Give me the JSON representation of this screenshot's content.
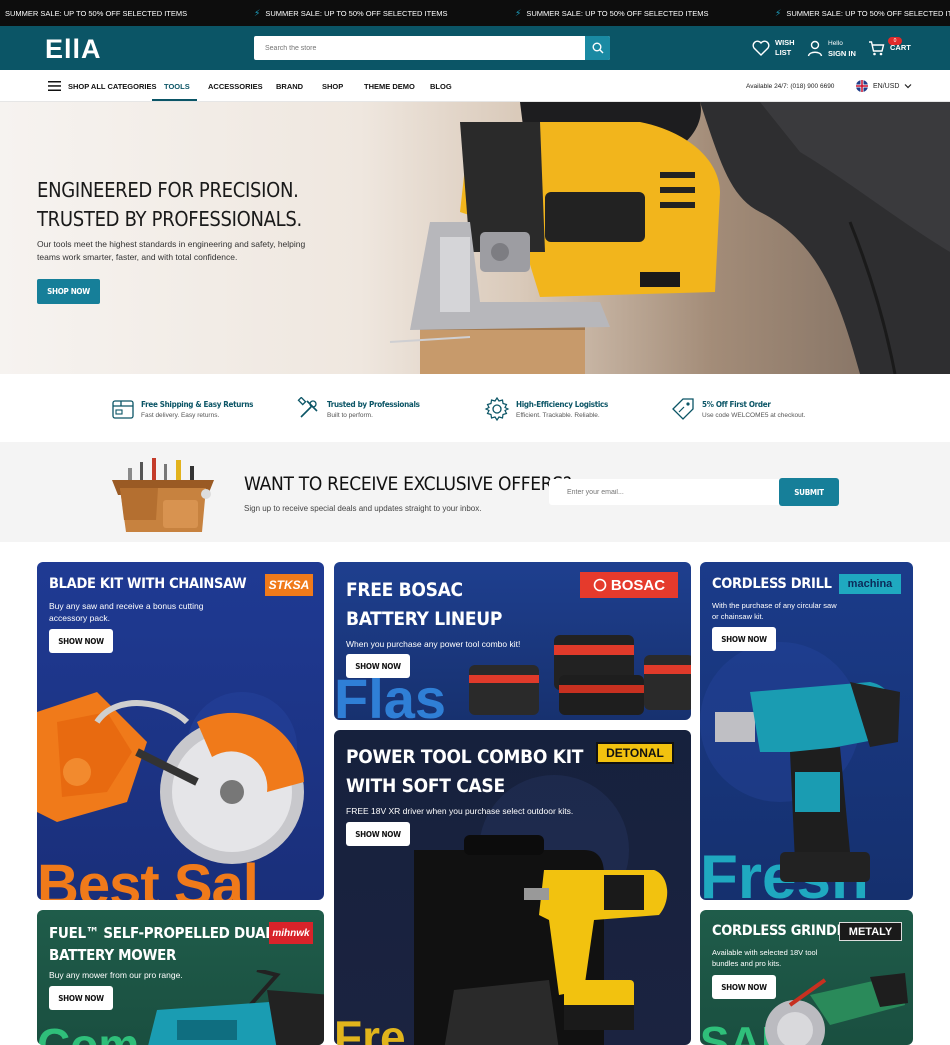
{
  "announcement": {
    "text": "SUMMER SALE: UP TO 50% OFF SELECTED ITEMS"
  },
  "header": {
    "logo": "EllA",
    "search_placeholder": "Search the store",
    "wishlist_line1": "WISH",
    "wishlist_line2": "LIST",
    "account_line1": "Hello",
    "account_line2": "SIGN IN",
    "cart_label": "CART",
    "cart_count": "0"
  },
  "nav": {
    "all_categories": "SHOP ALL CATEGORIES",
    "items": [
      "TOOLS",
      "ACCESSORIES",
      "BRAND",
      "SHOP",
      "THEME DEMO",
      "BLOG"
    ],
    "contact": "Available 24/7: (018) 900 6690",
    "language": "EN/USD"
  },
  "hero": {
    "title_line1": "ENGINEERED FOR PRECISION.",
    "title_line2": "TRUSTED BY PROFESSIONALS.",
    "subtitle": "Our tools meet the highest standards in engineering and safety, helping teams work smarter, faster, and with total confidence.",
    "button": "SHOP NOW"
  },
  "features": [
    {
      "title": "Free Shipping & Easy Returns",
      "sub": "Fast delivery. Easy returns."
    },
    {
      "title": "Trusted by Professionals",
      "sub": "Built to perform."
    },
    {
      "title": "High-Efficiency Logistics",
      "sub": "Efficient. Trackable. Reliable."
    },
    {
      "title": "5% Off First Order",
      "sub": "Use code WELCOME5 at checkout."
    }
  ],
  "newsletter": {
    "title": "WANT TO RECEIVE EXCLUSIVE OFFERS?",
    "sub": "Sign up to receive special deals and updates straight to your inbox.",
    "placeholder": "Enter your email...",
    "button": "SUBMIT"
  },
  "cards": {
    "blade": {
      "title": "BLADE KIT WITH CHAINSAW",
      "text": "Buy any saw and receive a bonus cutting accessory pack.",
      "button": "SHOW NOW",
      "brand": "STKSA",
      "bigword": "Best Sal"
    },
    "bosac": {
      "title_line1": "FREE BOSAC",
      "title_line2": "BATTERY LINEUP",
      "text": "When you purchase any power tool combo kit!",
      "button": "SHOW NOW",
      "brand": "BOSAC",
      "bigword": "Flas"
    },
    "drill": {
      "title": "CORDLESS DRILL",
      "text": "With the purchase of any circular saw or chainsaw kit.",
      "button": "SHOW NOW",
      "brand": "machina",
      "bigword": "Fresh"
    },
    "combo": {
      "title_line1": "POWER TOOL COMBO KIT",
      "title_line2": "WITH SOFT CASE",
      "text": "FREE 18V XR driver when you purchase select outdoor kits.",
      "button": "SHOW NOW",
      "brand": "DETONAL",
      "bigword": "Fre"
    },
    "mower": {
      "title_line1": "FUEL™ SELF-PROPELLED DUAL",
      "title_line2": "BATTERY MOWER",
      "text": "Buy any mower from our pro range.",
      "button": "SHOW NOW",
      "brand": "mihnwk",
      "bigword": "Com"
    },
    "grinder": {
      "title": "CORDLESS GRINDER",
      "text": "Available with selected 18V tool bundles and pro kits.",
      "button": "SHOW NOW",
      "brand": "METALY",
      "bigword": "SALE"
    }
  },
  "colors": {
    "primary": "#0b5566",
    "accent": "#167f99",
    "announce_bg": "#0d0d0d"
  }
}
